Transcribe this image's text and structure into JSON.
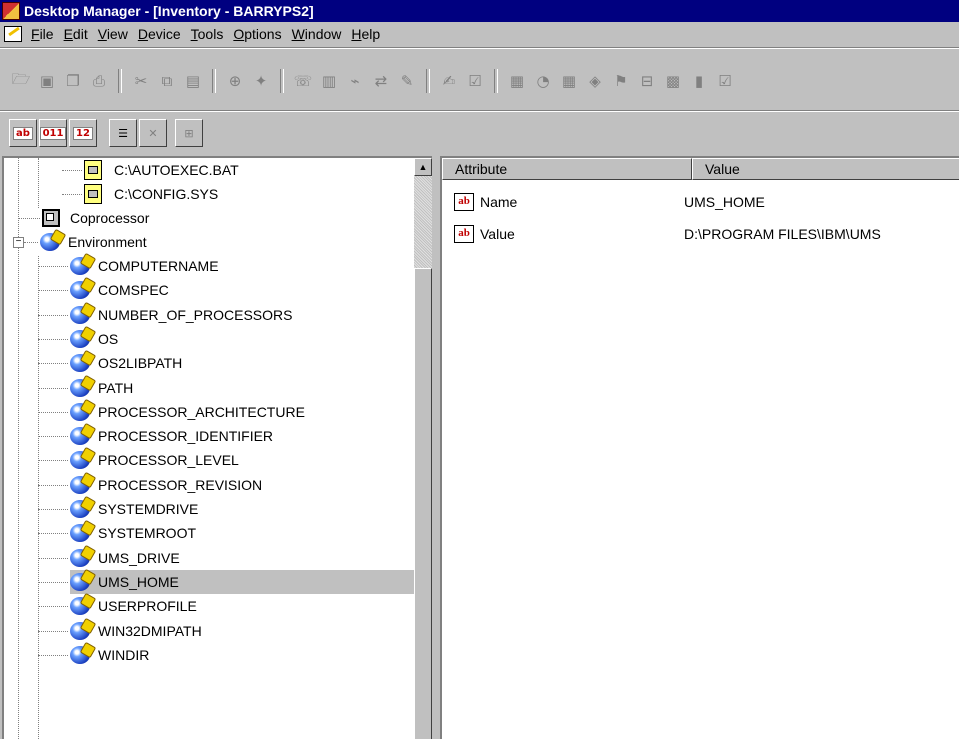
{
  "window": {
    "title": "Desktop Manager - [Inventory - BARRYPS2]"
  },
  "menu": [
    {
      "label": "File",
      "key": "F",
      "rest": "ile"
    },
    {
      "label": "Edit",
      "key": "E",
      "rest": "dit"
    },
    {
      "label": "View",
      "key": "V",
      "rest": "iew"
    },
    {
      "label": "Device",
      "key": "D",
      "rest": "evice"
    },
    {
      "label": "Tools",
      "key": "T",
      "rest": "ools"
    },
    {
      "label": "Options",
      "key": "O",
      "rest": "ptions"
    },
    {
      "label": "Window",
      "key": "W",
      "rest": "indow"
    },
    {
      "label": "Help",
      "key": "H",
      "rest": "elp"
    }
  ],
  "toolbar2": {
    "b1": "ab",
    "b2": "011",
    "b3": "12"
  },
  "tree": {
    "files": [
      "C:\\AUTOEXEC.BAT",
      "C:\\CONFIG.SYS"
    ],
    "coprocessor": "Coprocessor",
    "environment": "Environment",
    "env_vars": [
      "COMPUTERNAME",
      "COMSPEC",
      "NUMBER_OF_PROCESSORS",
      "OS",
      "OS2LIBPATH",
      "PATH",
      "PROCESSOR_ARCHITECTURE",
      "PROCESSOR_IDENTIFIER",
      "PROCESSOR_LEVEL",
      "PROCESSOR_REVISION",
      "SYSTEMDRIVE",
      "SYSTEMROOT",
      "UMS_DRIVE",
      "UMS_HOME",
      "USERPROFILE",
      "WIN32DMIPATH",
      "WINDIR"
    ],
    "selected": "UMS_HOME"
  },
  "list": {
    "columns": {
      "attribute": "Attribute",
      "value": "Value"
    },
    "rows": [
      {
        "attribute": "Name",
        "value": "UMS_HOME"
      },
      {
        "attribute": "Value",
        "value": "D:\\PROGRAM FILES\\IBM\\UMS"
      }
    ],
    "icon_text": "ab"
  },
  "colors": {
    "title_bg": "#000080",
    "face": "#c0c0c0",
    "selected_row": "#c0c0c0"
  }
}
